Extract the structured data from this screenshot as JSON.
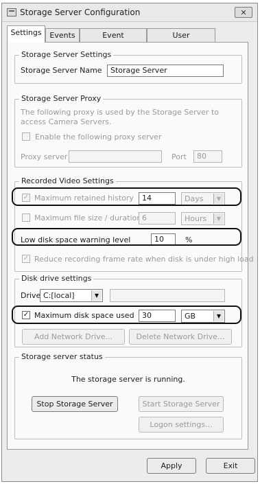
{
  "window": {
    "title": "Storage Server Configuration",
    "close_label": "✕"
  },
  "tabs": [
    {
      "label": "Settings"
    },
    {
      "label": "Events"
    },
    {
      "label": "Event Notification"
    },
    {
      "label": "User Management"
    }
  ],
  "storage_settings": {
    "legend": "Storage Server Settings",
    "name_label": "Storage Server Name",
    "name_value": "Storage Server"
  },
  "proxy": {
    "legend": "Storage Server Proxy",
    "description": "The following proxy is used by the Storage Server to access Camera Servers.",
    "enable_label": "Enable the following proxy server",
    "server_label": "Proxy server",
    "server_value": "",
    "port_label": "Port",
    "port_value": "80"
  },
  "recorded": {
    "legend": "Recorded Video Settings",
    "retained_label": "Maximum retained history",
    "retained_value": "14",
    "retained_unit": "Days",
    "filesize_label": "Maximum file size / duration",
    "filesize_value": "6",
    "filesize_unit": "Hours",
    "lowdisk_label": "Low disk space warning level",
    "lowdisk_value": "10",
    "lowdisk_unit": "%",
    "reduce_label": "Reduce recording frame rate when disk is under high load"
  },
  "disk": {
    "legend": "Disk drive settings",
    "drive_label": "Drive",
    "drive_value": "C:[local]",
    "drive_info": "",
    "maxdisk_label": "Maximum disk space used",
    "maxdisk_value": "30",
    "maxdisk_unit": "GB",
    "add_label": "Add Network Drive...",
    "delete_label": "Delete Network Drive..."
  },
  "status": {
    "legend": "Storage server status",
    "text": "The storage server is running.",
    "stop_label": "Stop Storage Server",
    "start_label": "Start Storage Server",
    "logon_label": "Logon settings..."
  },
  "footer": {
    "apply_label": "Apply",
    "exit_label": "Exit"
  }
}
